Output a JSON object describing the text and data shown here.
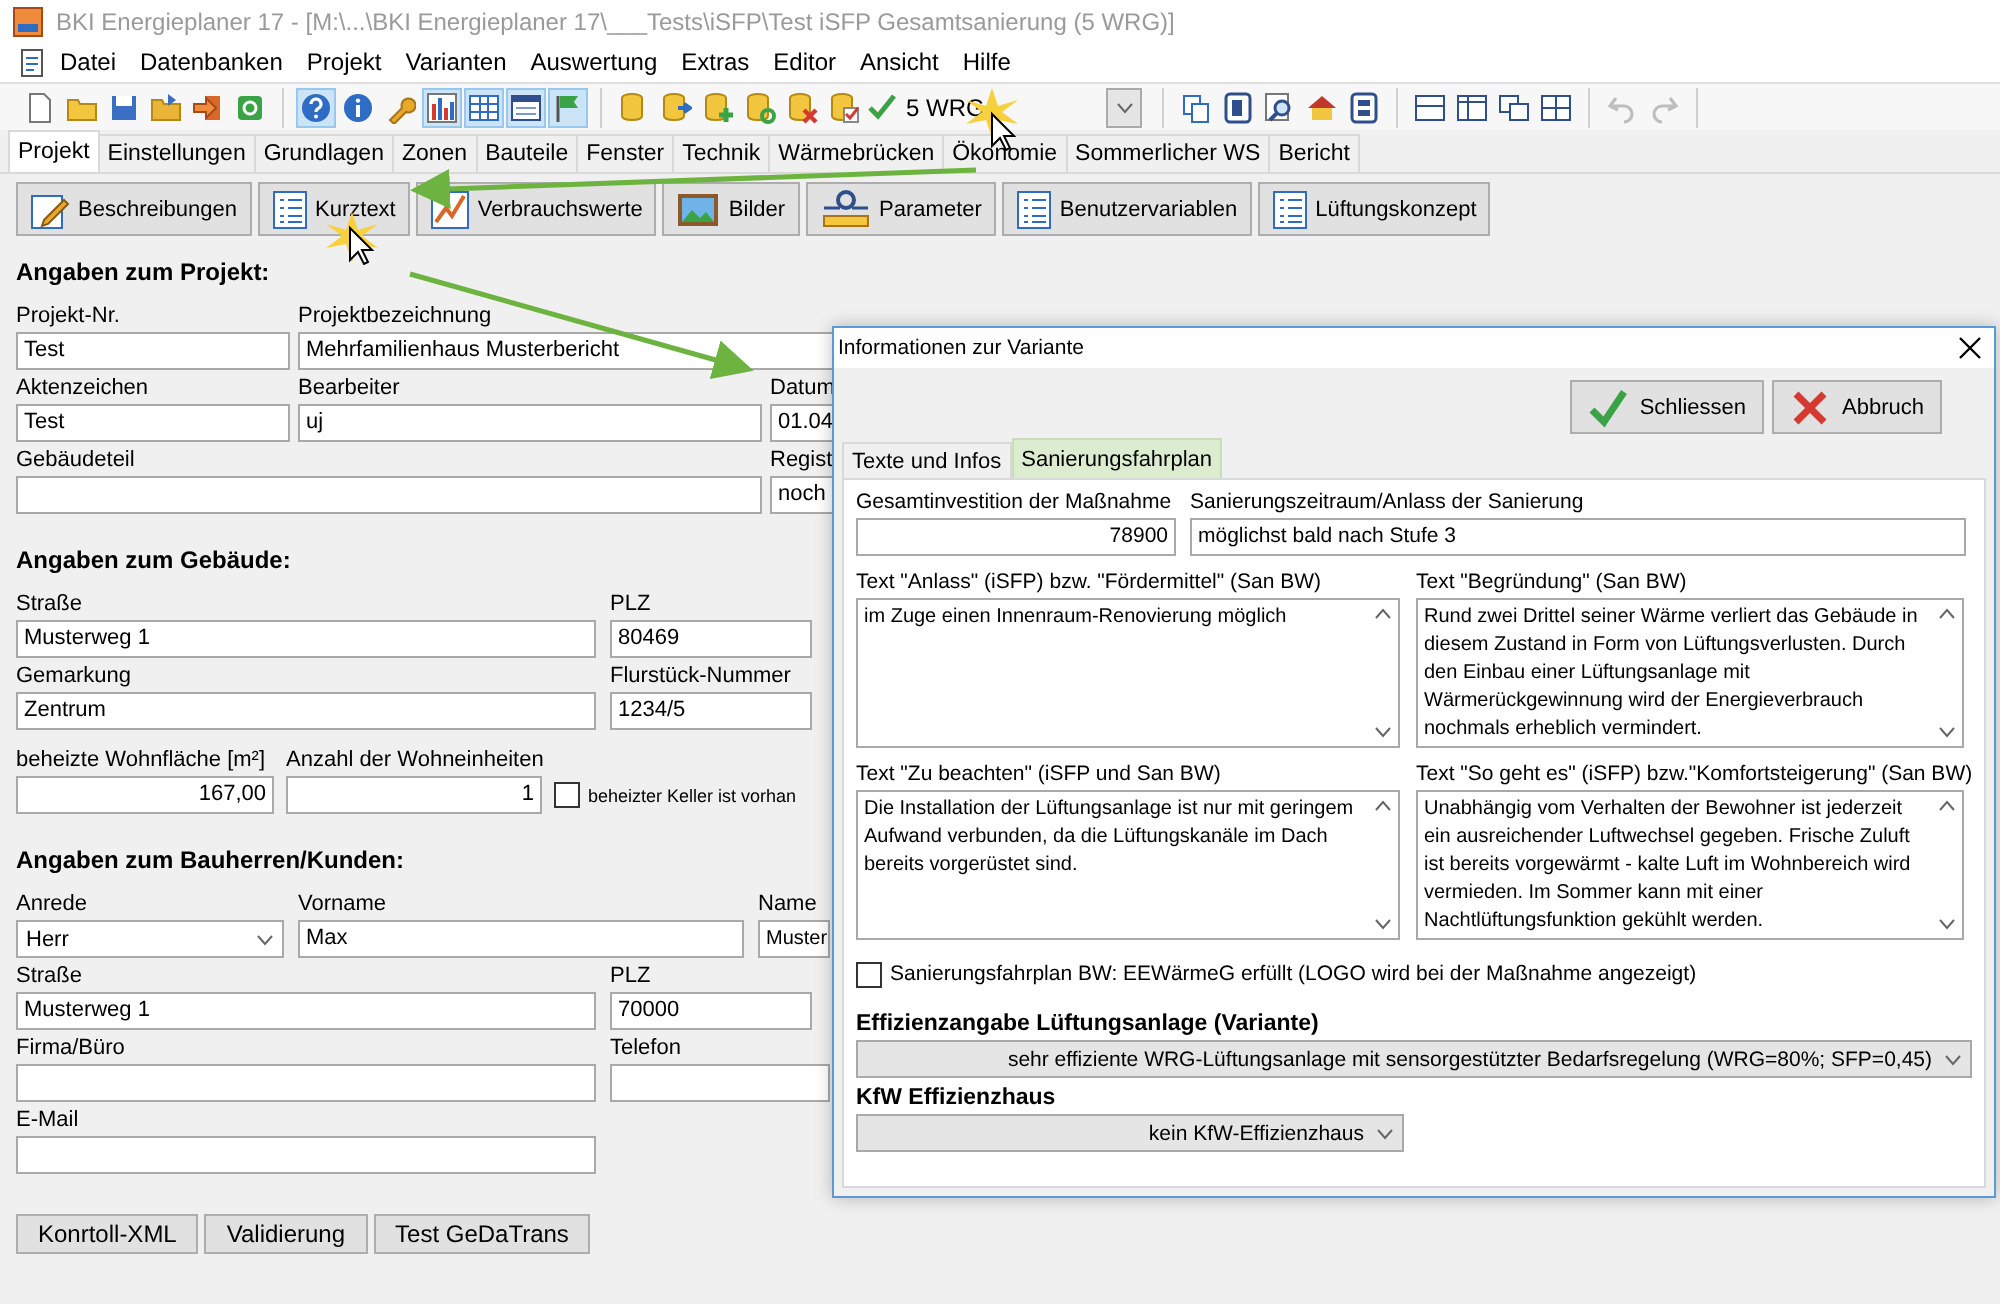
{
  "title_bar": {
    "title": "BKI Energieplaner 17 - [M:\\...\\BKI Energieplaner 17\\___Tests\\iSFP\\Test iSFP Gesamtsanierung (5 WRG)]"
  },
  "menu": [
    "Datei",
    "Datenbanken",
    "Projekt",
    "Varianten",
    "Auswertung",
    "Extras",
    "Editor",
    "Ansicht",
    "Hilfe"
  ],
  "toolbar": {
    "groups": [
      {
        "buttons": [
          {
            "pressed": false
          },
          {
            "pressed": false
          },
          {
            "pressed": false
          },
          {
            "pressed": false
          },
          {
            "pressed": false
          },
          {
            "pressed": false
          }
        ]
      },
      {
        "buttons": [
          {
            "pressed": true
          },
          {
            "pressed": false
          },
          {
            "pressed": false
          },
          {
            "pressed": true
          },
          {
            "pressed": true
          },
          {
            "pressed": true
          },
          {
            "pressed": true
          }
        ]
      },
      {
        "buttons": [
          {
            "pressed": false
          },
          {
            "pressed": false
          },
          {
            "pressed": false
          },
          {
            "pressed": false
          },
          {
            "pressed": false
          },
          {
            "pressed": false
          }
        ],
        "variant": "5 WRG"
      },
      {
        "buttons": [
          {
            "pressed": false
          },
          {
            "pressed": false
          },
          {
            "pressed": false
          },
          {
            "pressed": false
          },
          {
            "pressed": false
          }
        ]
      },
      {
        "buttons": [
          {
            "pressed": false
          },
          {
            "pressed": false
          },
          {
            "pressed": false
          },
          {
            "pressed": false
          }
        ]
      },
      {
        "buttons": [
          {
            "disabled": true
          },
          {
            "disabled": true
          }
        ]
      }
    ]
  },
  "tabs": [
    {
      "label": "Projekt",
      "selected": true
    },
    {
      "label": "Einstellungen",
      "selected": false
    },
    {
      "label": "Grundlagen",
      "selected": false
    },
    {
      "label": "Zonen",
      "selected": false
    },
    {
      "label": "Bauteile",
      "selected": false
    },
    {
      "label": "Fenster",
      "selected": false
    },
    {
      "label": "Technik",
      "selected": false
    },
    {
      "label": "Wärmebrücken",
      "selected": false
    },
    {
      "label": "Ökonomie",
      "selected": false
    },
    {
      "label": "Sommerlicher WS",
      "selected": false
    },
    {
      "label": "Bericht",
      "selected": false
    }
  ],
  "actions": [
    "Beschreibungen",
    "Kurztext",
    "Verbrauchswerte",
    "Bilder",
    "Parameter",
    "Benutzervariablen",
    "Lüftungskonzept"
  ],
  "project": {
    "heading": "Angaben zum Projekt:",
    "number": {
      "label": "Projekt-Nr.",
      "value": "Test"
    },
    "name": {
      "label": "Projektbezeichnung",
      "value": "Mehrfamilienhaus Musterbericht"
    },
    "file_no": {
      "label": "Aktenzeichen",
      "value": "Test"
    },
    "editor": {
      "label": "Bearbeiter",
      "value": "uj"
    },
    "date": {
      "label": "Datum",
      "value": "01.04"
    },
    "part": {
      "label": "Gebäudeteil"
    },
    "registry": {
      "label": "Regist",
      "value": "noch"
    }
  },
  "building": {
    "heading": "Angaben zum Gebäude:",
    "street": {
      "label": "Straße",
      "value": "Musterweg 1"
    },
    "zip": {
      "label": "PLZ",
      "value": "80469"
    },
    "district": {
      "label": "Gemarkung",
      "value": "Zentrum"
    },
    "parcel": {
      "label": "Flurstück-Nummer",
      "value": "1234/5"
    },
    "area": {
      "label": "beheizte Wohnfläche [m²]",
      "value": "167,00"
    },
    "units": {
      "label": "Anzahl der Wohneinheiten",
      "value": "1"
    },
    "basement": {
      "label": "beheizter Keller ist vorhan",
      "checked": false
    }
  },
  "client": {
    "heading": "Angaben zum Bauherren/Kunden:",
    "salutation": {
      "label": "Anrede",
      "value": "Herr"
    },
    "first_name": {
      "label": "Vorname",
      "value": "Max"
    },
    "last_name": {
      "label": "Name",
      "value": "Muster"
    },
    "street": {
      "label": "Straße",
      "value": "Musterweg 1"
    },
    "zip": {
      "label": "PLZ",
      "value": "70000"
    },
    "company": {
      "label": "Firma/Büro"
    },
    "phone": {
      "label": "Telefon"
    },
    "email": {
      "label": "E-Mail"
    }
  },
  "bottom_buttons": [
    "Konrtoll-XML",
    "Validierung",
    "Test GeDaTrans"
  ],
  "dialog": {
    "title": "Informationen zur Variante",
    "buttons": [
      {
        "label": "Schliessen",
        "kind": "ok"
      },
      {
        "label": "Abbruch",
        "kind": "cancel"
      }
    ],
    "tabs": [
      {
        "label": "Texte und Infos",
        "selected": false
      },
      {
        "label": "Sanierungsfahrplan",
        "selected": true
      }
    ],
    "investment": {
      "label": "Gesamtinvestition der Maßnahme",
      "value": "78900"
    },
    "period": {
      "label": "Sanierungszeitraum/Anlass der Sanierung",
      "value": "möglichst bald nach Stufe 3"
    },
    "texts": [
      {
        "label": "Text \"Anlass\" (iSFP) bzw. \"Fördermittel\" (San BW)",
        "value": "im Zuge einen Innenraum-Renovierung möglich"
      },
      {
        "label": "Text \"Begründung\" (San BW)",
        "value": "Rund zwei Drittel seiner Wärme verliert das Gebäude in diesem Zustand in Form von Lüftungsverlusten. Durch den Einbau einer Lüftungsanlage mit Wärmerückgewinnung wird der Energieverbrauch nochmals erheblich vermindert."
      },
      {
        "label": "Text \"Zu beachten\" (iSFP und San BW)",
        "value": "Die Installation der Lüftungsanlage ist nur mit geringem Aufwand verbunden, da die Lüftungskanäle im Dach bereits vorgerüstet sind."
      },
      {
        "label": "Text \"So geht es\" (iSFP) bzw.\"Komfortsteigerung\" (San BW)",
        "value": "Unabhängig vom Verhalten der Bewohner ist jederzeit ein ausreichender Luftwechsel gegeben. Frische Zuluft ist bereits vorgewärmt - kalte Luft im Wohnbereich wird vermieden. Im Sommer kann mit einer Nachtlüftungsfunktion gekühlt werden."
      }
    ],
    "eewaermeg": {
      "label": "Sanierungsfahrplan BW: EEWärmeG erfüllt (LOGO wird bei der Maßnahme angezeigt)",
      "checked": false
    },
    "efficiency": {
      "heading": "Effizienzangabe Lüftungsanlage (Variante)",
      "value": "sehr effiziente WRG-Lüftungsanlage mit sensorgestützter Bedarfsregelung (WRG=80%; SFP=0,45)"
    },
    "kfw": {
      "heading": "KfW Effizienzhaus",
      "value": "kein KfW-Effizienzhaus"
    }
  }
}
